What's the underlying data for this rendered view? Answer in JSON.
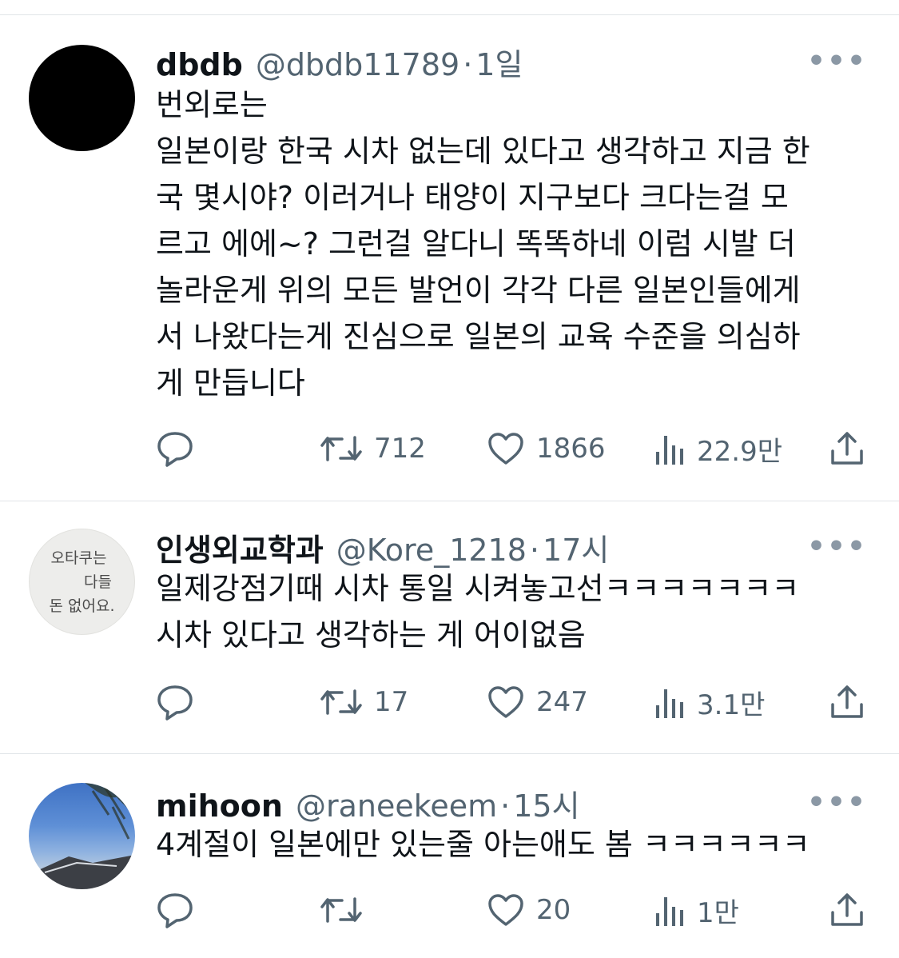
{
  "tweets": [
    {
      "name": "dbdb",
      "handle": "@dbdb11789",
      "separator": "·",
      "time": "1일",
      "more": "•••",
      "lines": [
        "번외로는",
        "일본이랑 한국 시차 없는데 있다고 생각하고 지금 한",
        "국 몇시야? 이러거나 태양이 지구보다 크다는걸 모",
        "르고 에에~? 그런걸 알다니 똑똑하네 이럼 시발 더",
        "놀라운게 위의 모든 발언이 각각 다른 일본인들에게",
        "서 나왔다는게 진심으로 일본의 교육 수준을 의심하",
        "게 만듭니다"
      ],
      "replies": "",
      "retweets": "712",
      "likes": "1866",
      "views": "22.9만",
      "avatar": "black-circle"
    },
    {
      "name": "인생외교학과",
      "handle": "@Kore_1218",
      "separator": "·",
      "time": "17시",
      "more": "•••",
      "lines": [
        "일제강점기때 시차 통일 시켜놓고선ㅋㅋㅋㅋㅋㅋㅋ",
        "시차 있다고 생각하는 게 어이없음"
      ],
      "replies": "",
      "retweets": "17",
      "likes": "247",
      "views": "3.1만",
      "avatar_text": [
        "오타쿠는",
        "다들",
        "돈 없어요."
      ]
    },
    {
      "name": "mihoon",
      "handle": "@raneekeem",
      "separator": "·",
      "time": "15시",
      "more": "•••",
      "lines": [
        "4계절이 일본에만 있는줄 아는애도 봄 ㅋㅋㅋㅋㅋㅋ"
      ],
      "replies": "",
      "retweets": "",
      "likes": "20",
      "views": "1만",
      "avatar": "sky-photo"
    }
  ],
  "icons": {
    "reply": "reply-icon",
    "retweet": "retweet-icon",
    "like": "heart-icon",
    "views": "views-icon",
    "share": "share-icon"
  },
  "colors": {
    "text": "#0f1419",
    "secondary": "#536471",
    "divider": "#e1e5e8"
  }
}
